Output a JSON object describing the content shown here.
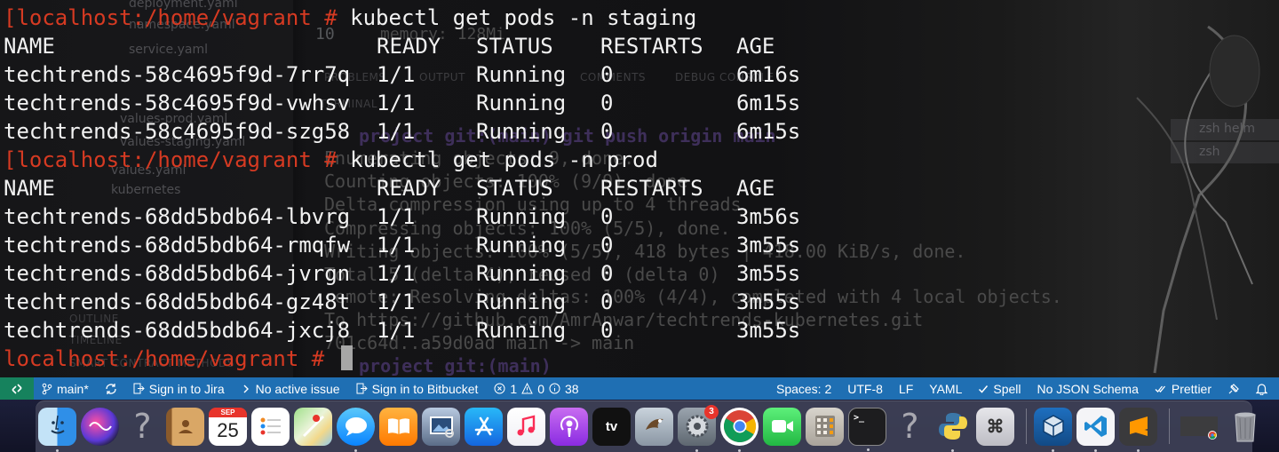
{
  "background_ghost": {
    "files": [
      "deployment.yaml",
      "namespace.yaml",
      "service.yaml",
      "values-prod.yaml",
      "values-staging.yaml",
      "values.yaml"
    ],
    "folder": "kubernetes",
    "outline": "OUTLINE",
    "timeline": "TIMELINE",
    "smart_contract": "SMART CONTRACT METHODS",
    "editor_lines": [
      {
        "num": "10",
        "text": "memory: 128Mi"
      }
    ],
    "panel_tabs": [
      "PROBLEMS",
      "OUTPUT",
      "COMMENTS",
      "DEBUG CONSOLE",
      "TERMINAL"
    ],
    "ghost_terminal": [
      "project git:(main) git push origin main",
      "Enumerating objects: 9, done.",
      "Counting objects: 100% (9/9), done.",
      "Delta compression using up to 4 threads",
      "Compressing objects: 100% (5/5), done.",
      "Writing objects: 100% (5/5), 418 bytes | 418.00 KiB/s, done.",
      "Total 5 (delta 4), reused 0 (delta 0)",
      "remote: Resolving deltas: 100% (4/4), completed with 4 local objects.",
      "To https://github.com/AmrAnwar/techtrends-kubernetes.git",
      "   701c64d..a59d0ad  main -> main",
      "project git:(main) "
    ],
    "panel_shells": [
      "zsh helm",
      "zsh"
    ]
  },
  "terminal": {
    "prompt": "[localhost:/home/vagrant # ",
    "commands": [
      "kubectl get pods -n staging",
      "kubectl get pods -n prod"
    ],
    "headers": [
      "NAME",
      "READY",
      "STATUS",
      "RESTARTS",
      "AGE"
    ],
    "staging_rows": [
      [
        "techtrends-58c4695f9d-7rr7q",
        "1/1",
        "Running",
        "0",
        "6m16s"
      ],
      [
        "techtrends-58c4695f9d-vwhsv",
        "1/1",
        "Running",
        "0",
        "6m15s"
      ],
      [
        "techtrends-58c4695f9d-szg58",
        "1/1",
        "Running",
        "0",
        "6m15s"
      ]
    ],
    "prod_rows": [
      [
        "techtrends-68dd5bdb64-lbvrg",
        "1/1",
        "Running",
        "0",
        "3m56s"
      ],
      [
        "techtrends-68dd5bdb64-rmqfw",
        "1/1",
        "Running",
        "0",
        "3m55s"
      ],
      [
        "techtrends-68dd5bdb64-jvrgn",
        "1/1",
        "Running",
        "0",
        "3m55s"
      ],
      [
        "techtrends-68dd5bdb64-gz48t",
        "1/1",
        "Running",
        "0",
        "3m55s"
      ],
      [
        "techtrends-68dd5bdb64-jxcj8",
        "1/1",
        "Running",
        "0",
        "3m55s"
      ]
    ],
    "final_prompt": "localhost:/home/vagrant # "
  },
  "statusbar": {
    "branch": "main*",
    "jira": "Sign in to Jira",
    "issue": "No active issue",
    "bitbucket": "Sign in to Bitbucket",
    "errors": "1",
    "warnings": "0",
    "infos": "38",
    "spaces": "Spaces: 2",
    "encoding": "UTF-8",
    "eol": "LF",
    "language": "YAML",
    "spell": "Spell",
    "schema": "No JSON Schema",
    "prettier": "Prettier",
    "colors": {
      "bar": "#1f6fb3",
      "remote": "#16825d"
    }
  },
  "dock": {
    "calendar_month": "SEP",
    "calendar_day": "25",
    "appletv_label": "tv",
    "system_prefs_badge": "3",
    "terminal_glyph": ">_",
    "keychain_glyph": "⌘",
    "question_glyph": "?"
  }
}
